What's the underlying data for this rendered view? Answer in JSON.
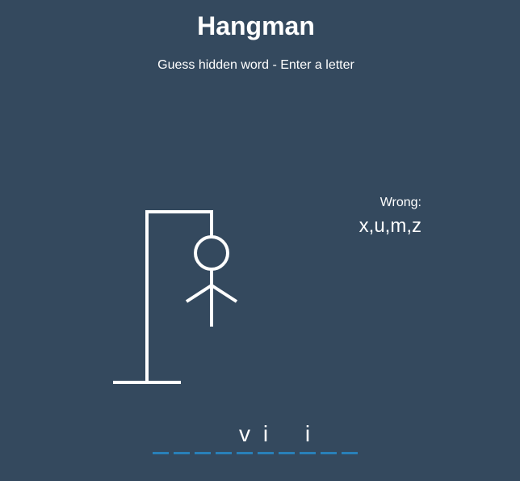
{
  "header": {
    "title": "Hangman",
    "subtitle": "Guess hidden word - Enter a letter"
  },
  "wrong": {
    "label": "Wrong:",
    "letters": "x,u,m,z"
  },
  "word": {
    "slots": [
      "",
      "",
      "",
      "",
      "v",
      "i",
      "",
      "i",
      "",
      "",
      ""
    ]
  },
  "colors": {
    "background": "#34495e",
    "slot_underline": "#2980b9",
    "text": "#ffffff"
  }
}
